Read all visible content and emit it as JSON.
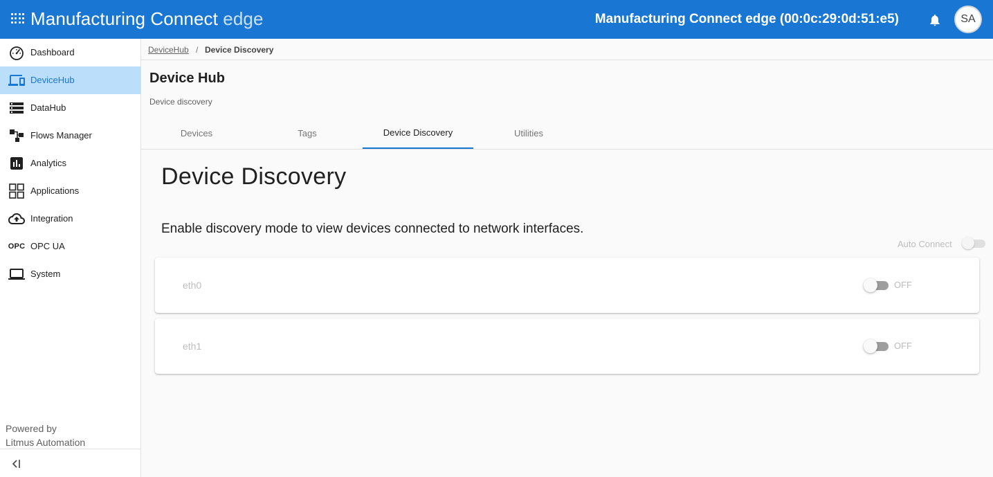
{
  "topbar": {
    "app_title_main": "Manufacturing Connect",
    "app_title_edge": "edge",
    "device_title": "Manufacturing Connect edge (00:0c:29:0d:51:e5)",
    "avatar_initials": "SA",
    "accent_color": "#1976d2"
  },
  "sidebar": {
    "items": [
      {
        "label": "Dashboard",
        "icon": "speedometer-icon"
      },
      {
        "label": "DeviceHub",
        "icon": "devices-icon",
        "active": true
      },
      {
        "label": "DataHub",
        "icon": "storage-icon"
      },
      {
        "label": "Flows Manager",
        "icon": "flow-icon"
      },
      {
        "label": "Analytics",
        "icon": "analytics-icon"
      },
      {
        "label": "Applications",
        "icon": "apps-grid-icon"
      },
      {
        "label": "Integration",
        "icon": "cloud-upload-icon"
      },
      {
        "label": "OPC UA",
        "icon": "opc-icon",
        "icon_text": "OPC"
      },
      {
        "label": "System",
        "icon": "laptop-icon"
      }
    ],
    "powered_line1": "Powered by",
    "powered_line2": "Litmus Automation"
  },
  "breadcrumb": {
    "link": "DeviceHub",
    "separator": "/",
    "current": "Device Discovery"
  },
  "header": {
    "title": "Device Hub",
    "subtitle": "Device discovery"
  },
  "tabs": [
    {
      "label": "Devices"
    },
    {
      "label": "Tags"
    },
    {
      "label": "Device Discovery",
      "active": true
    },
    {
      "label": "Utilities"
    }
  ],
  "main": {
    "title": "Device Discovery",
    "description": "Enable discovery mode to view devices connected to network interfaces.",
    "auto_connect_label": "Auto Connect",
    "interfaces": [
      {
        "name": "eth0",
        "state": "OFF"
      },
      {
        "name": "eth1",
        "state": "OFF"
      }
    ]
  }
}
